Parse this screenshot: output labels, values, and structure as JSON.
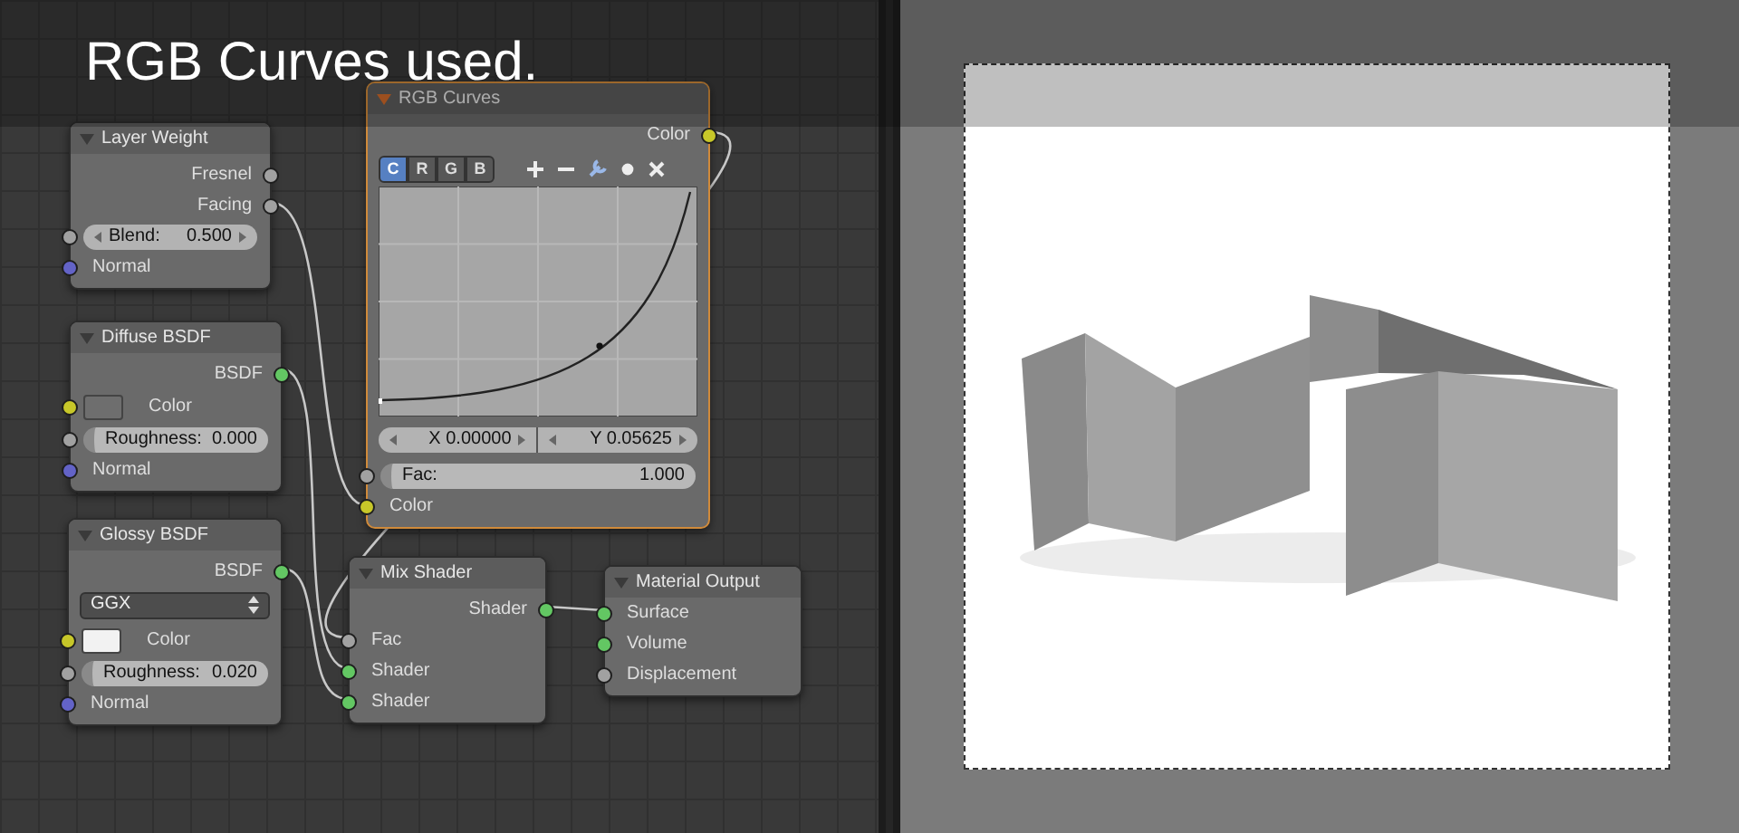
{
  "caption": "RGB Curves used.",
  "nodes": [
    {
      "title": "Layer Weight",
      "selected": false,
      "rows": [
        {
          "kind": "output",
          "label": "Fresnel",
          "socket": {
            "color": "#a1a1a1"
          }
        },
        {
          "kind": "output",
          "label": "Facing",
          "socket": {
            "color": "#a1a1a1"
          }
        },
        {
          "kind": "number",
          "label": "Blend:",
          "value": "0.500",
          "socket": {
            "color": "#a1a1a1"
          }
        },
        {
          "kind": "input",
          "label": "Normal",
          "socket": {
            "color": "#6363c7"
          }
        }
      ]
    },
    {
      "title": "Diffuse BSDF",
      "selected": false,
      "rows": [
        {
          "kind": "output",
          "label": "BSDF",
          "socket": {
            "color": "#63c763"
          }
        },
        {
          "kind": "color",
          "label": "Color",
          "color": "#6e6e6e",
          "socket": {
            "color": "#c7c729"
          }
        },
        {
          "kind": "slider",
          "label": "Roughness:",
          "value": "0.000",
          "socket": {
            "color": "#a1a1a1"
          }
        },
        {
          "kind": "input",
          "label": "Normal",
          "socket": {
            "color": "#6363c7"
          }
        }
      ]
    },
    {
      "title": "Glossy BSDF",
      "selected": false,
      "rows": [
        {
          "kind": "output",
          "label": "BSDF",
          "socket": {
            "color": "#63c763"
          }
        },
        {
          "kind": "dropdown",
          "value": "GGX"
        },
        {
          "kind": "color",
          "label": "Color",
          "color": "#f2f2f2",
          "socket": {
            "color": "#c7c729"
          }
        },
        {
          "kind": "slider",
          "label": "Roughness:",
          "value": "0.020",
          "socket": {
            "color": "#a1a1a1"
          }
        },
        {
          "kind": "input",
          "label": "Normal",
          "socket": {
            "color": "#6363c7"
          }
        }
      ]
    },
    {
      "title": "RGB Curves",
      "selected": true,
      "rows": [
        {
          "kind": "output",
          "label": "Color",
          "socket": {
            "color": "#c7c729"
          }
        },
        {
          "kind": "curve",
          "channels": [
            {
              "label": "C",
              "selected": true
            },
            {
              "label": "R",
              "selected": false
            },
            {
              "label": "G",
              "selected": false
            },
            {
              "label": "B",
              "selected": false
            }
          ],
          "x_field": "X 0.00000",
          "y_field": "Y 0.05625"
        },
        {
          "kind": "slider",
          "label": "Fac:",
          "value": "1.000",
          "socket": {
            "color": "#a1a1a1"
          }
        },
        {
          "kind": "input",
          "label": "Color",
          "socket": {
            "color": "#c7c729"
          }
        }
      ]
    },
    {
      "title": "Mix Shader",
      "selected": false,
      "rows": [
        {
          "kind": "output",
          "label": "Shader",
          "socket": {
            "color": "#63c763"
          }
        },
        {
          "kind": "input",
          "label": "Fac",
          "socket": {
            "color": "#a1a1a1"
          }
        },
        {
          "kind": "input",
          "label": "Shader",
          "socket": {
            "color": "#63c763"
          }
        },
        {
          "kind": "input",
          "label": "Shader",
          "socket": {
            "color": "#63c763"
          }
        }
      ]
    },
    {
      "title": "Material Output",
      "selected": false,
      "rows": [
        {
          "kind": "input",
          "label": "Surface",
          "socket": {
            "color": "#63c763"
          }
        },
        {
          "kind": "input",
          "label": "Volume",
          "socket": {
            "color": "#63c763"
          }
        },
        {
          "kind": "input",
          "label": "Displacement",
          "socket": {
            "color": "#a1a1a1"
          }
        }
      ]
    }
  ]
}
